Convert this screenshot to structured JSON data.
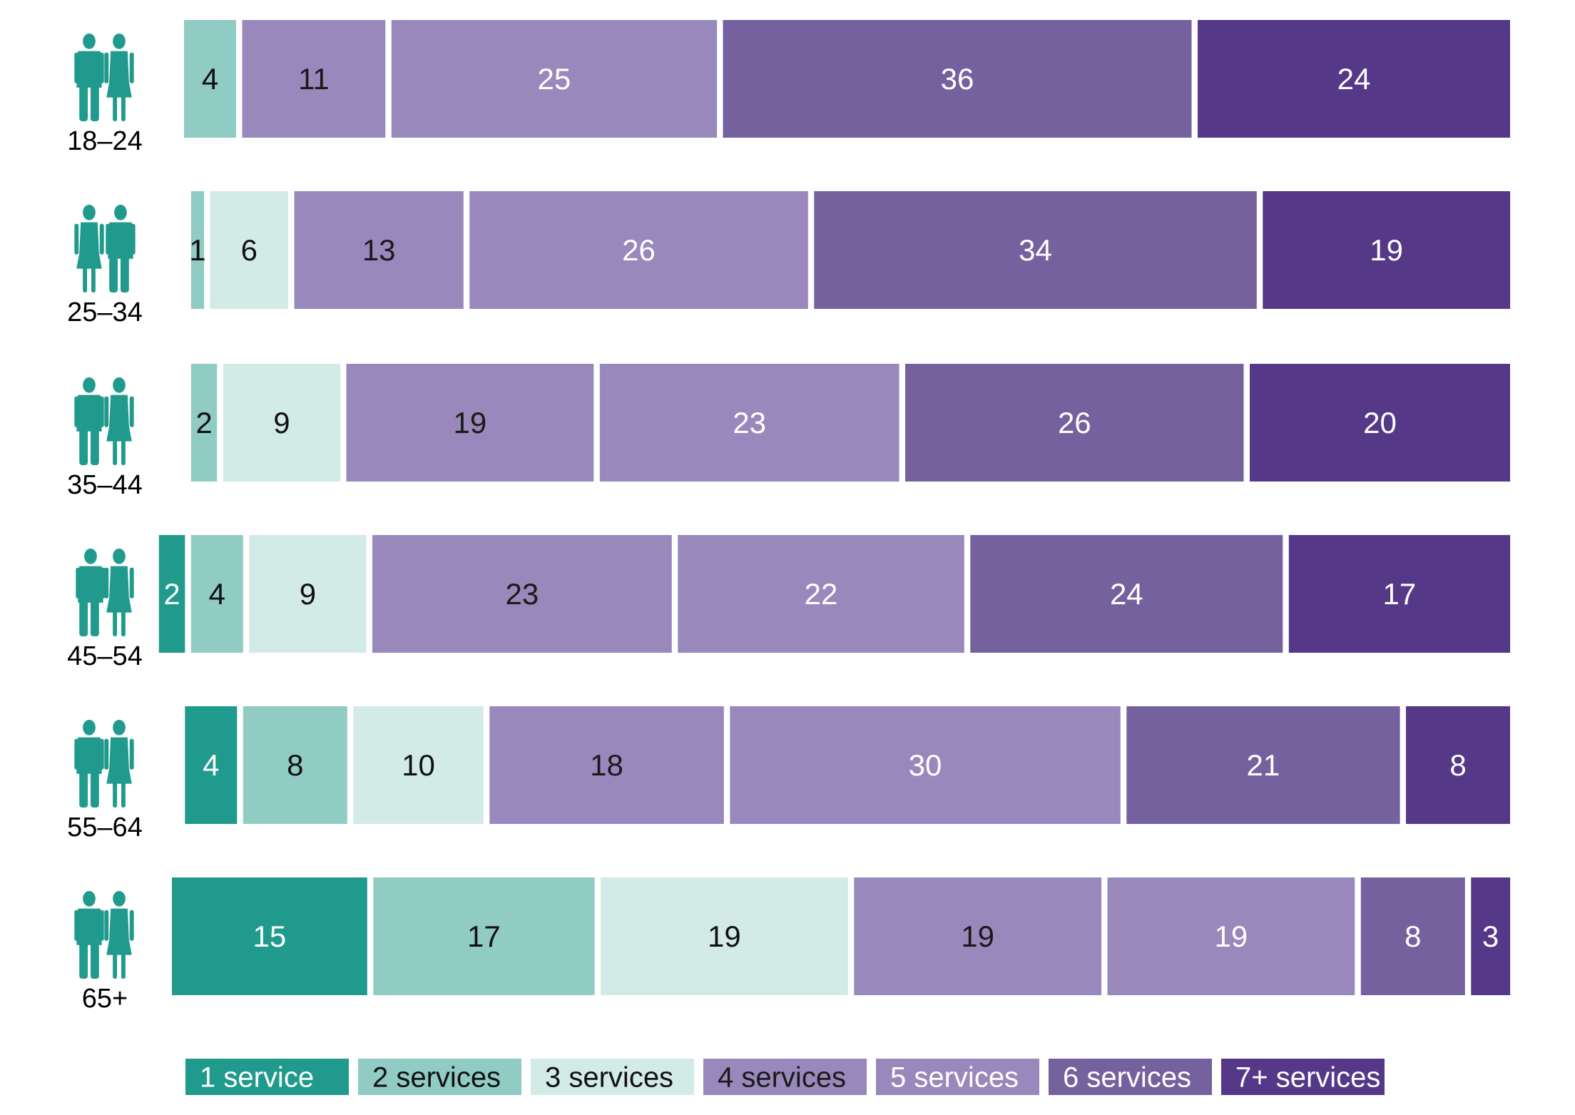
{
  "chart_data": {
    "type": "bar",
    "orientation": "horizontal",
    "stacked": true,
    "title": "",
    "xlabel": "",
    "ylabel": "",
    "units": "percent",
    "categories": [
      "18–24",
      "25–34",
      "35–44",
      "45–54",
      "55–64",
      "65+"
    ],
    "series": [
      {
        "name": "1 service",
        "color": "#1f9a8c",
        "text_color": "#ffffff",
        "values": [
          0,
          0,
          0,
          2,
          4,
          15
        ]
      },
      {
        "name": "2 services",
        "color": "#90cbc4",
        "text_color": "#111111",
        "values": [
          4,
          1,
          2,
          4,
          8,
          17
        ]
      },
      {
        "name": "3 services",
        "color": "#d3ebe7",
        "text_color": "#111111",
        "values": [
          0,
          6,
          9,
          9,
          10,
          19
        ]
      },
      {
        "name": "4 services",
        "color": "#9988bb",
        "text_color": "#1a1a1a",
        "values": [
          11,
          13,
          19,
          23,
          18,
          19
        ]
      },
      {
        "name": "5 services",
        "color": "#9988bb",
        "text_color": "#ffffff",
        "values": [
          25,
          26,
          23,
          22,
          30,
          19
        ]
      },
      {
        "name": "6 services",
        "color": "#76619f",
        "text_color": "#ffffff",
        "values": [
          36,
          34,
          26,
          24,
          21,
          8
        ]
      },
      {
        "name": "7+ services",
        "color": "#553888",
        "text_color": "#ffffff",
        "values": [
          24,
          19,
          20,
          17,
          8,
          3
        ]
      }
    ],
    "data_labels": true,
    "grid": false,
    "legend": {
      "position": "bottom",
      "entries": [
        "1 service",
        "2 services",
        "3 services",
        "4 services",
        "5 services",
        "6 services",
        "7+ services"
      ]
    },
    "category_icons": [
      "young-adults-silhouette-icon",
      "adults-25-34-silhouette-icon",
      "adults-35-44-silhouette-icon",
      "adults-45-54-silhouette-icon",
      "adults-55-64-silhouette-icon",
      "seniors-silhouette-icon"
    ],
    "icon_color": "#1f9a8c"
  }
}
